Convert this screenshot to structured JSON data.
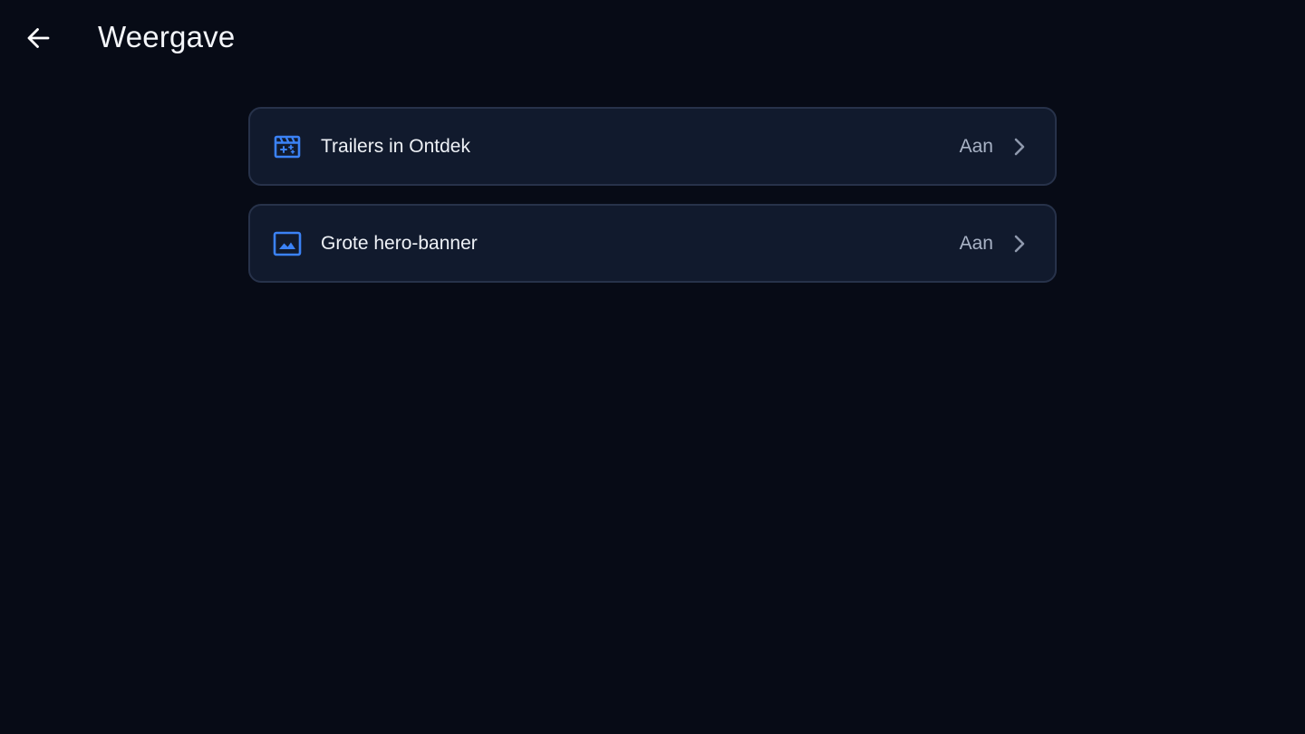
{
  "header": {
    "back_icon": "arrow-left-icon",
    "title": "Weergave"
  },
  "settings": [
    {
      "icon": "movie-clapper-icon",
      "label": "Trailers in Ontdek",
      "value": "Aan",
      "chevron_icon": "chevron-right-icon"
    },
    {
      "icon": "image-icon",
      "label": "Grote hero-banner",
      "value": "Aan",
      "chevron_icon": "chevron-right-icon"
    }
  ],
  "colors": {
    "background": "#070b16",
    "card_background": "#111a2d",
    "card_border": "#27324a",
    "accent_icon": "#3b82f6",
    "value_text": "#a9b3c6",
    "chevron": "#8f99ad"
  }
}
